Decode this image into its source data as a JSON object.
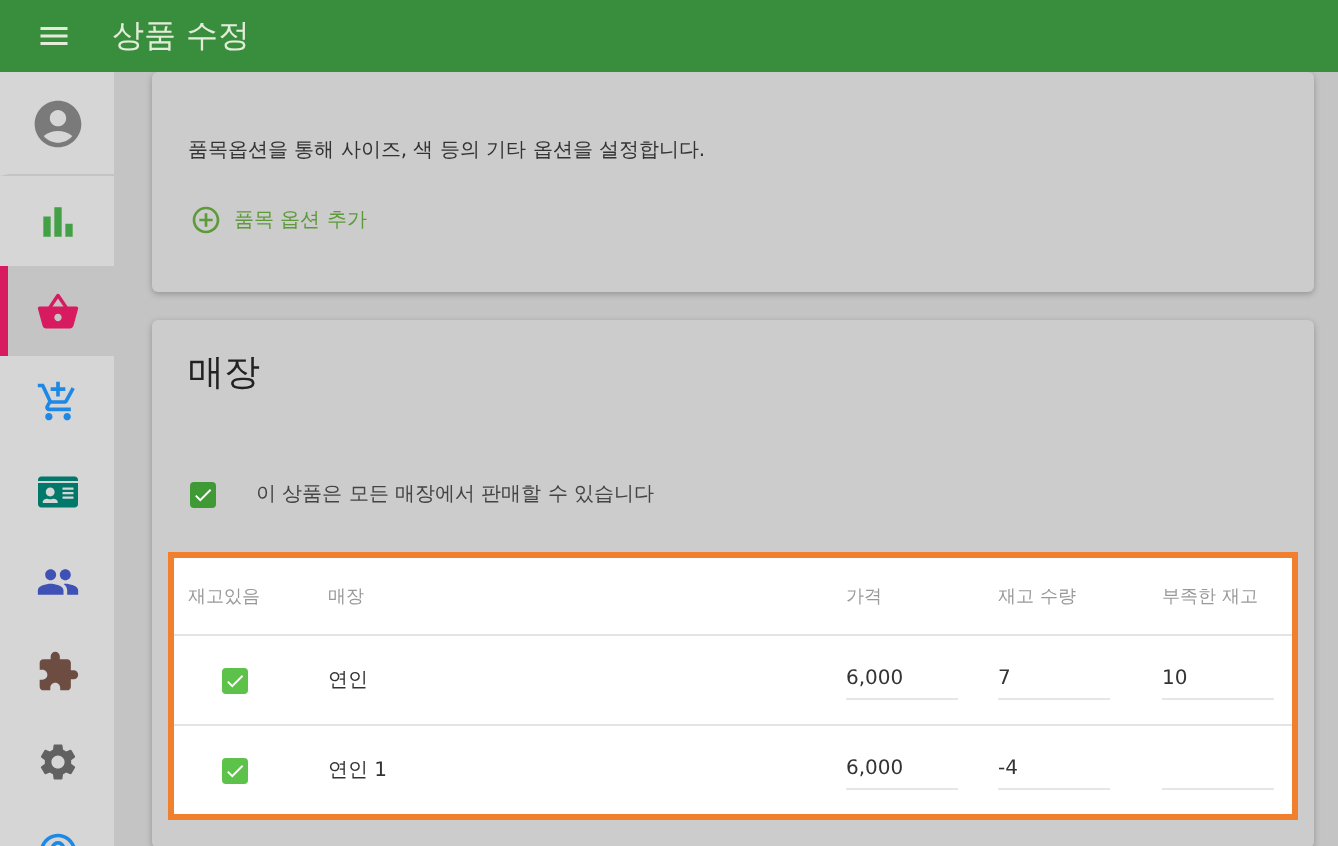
{
  "app_bar": {
    "title": "상품 수정"
  },
  "sidebar": {
    "items": [
      {
        "kind": "account",
        "selected": false
      },
      {
        "kind": "chart",
        "selected": false
      },
      {
        "kind": "basket",
        "selected": true
      },
      {
        "kind": "cart",
        "selected": false
      },
      {
        "kind": "card",
        "selected": false
      },
      {
        "kind": "people",
        "selected": false
      },
      {
        "kind": "puzzle",
        "selected": false
      },
      {
        "kind": "gear",
        "selected": false
      },
      {
        "kind": "help",
        "selected": false
      }
    ]
  },
  "options_card": {
    "description": "품목옵션을 통해 사이즈, 색 등의 기타 옵션을 설정합니다.",
    "add_button": "품목 옵션 추가"
  },
  "store_card": {
    "title": "매장",
    "all_stores": {
      "label": "이 상품은 모든 매장에서 판매할 수 있습니다",
      "checked": true
    },
    "table": {
      "columns": [
        "재고있음",
        "매장",
        "가격",
        "재고 수량",
        "부족한 재고"
      ],
      "rows": [
        {
          "in_stock": true,
          "store": "연인",
          "price": "6,000",
          "quantity": "7",
          "low_stock": "10"
        },
        {
          "in_stock": true,
          "store": "연인 1",
          "price": "6,000",
          "quantity": "-4"
        }
      ]
    }
  }
}
